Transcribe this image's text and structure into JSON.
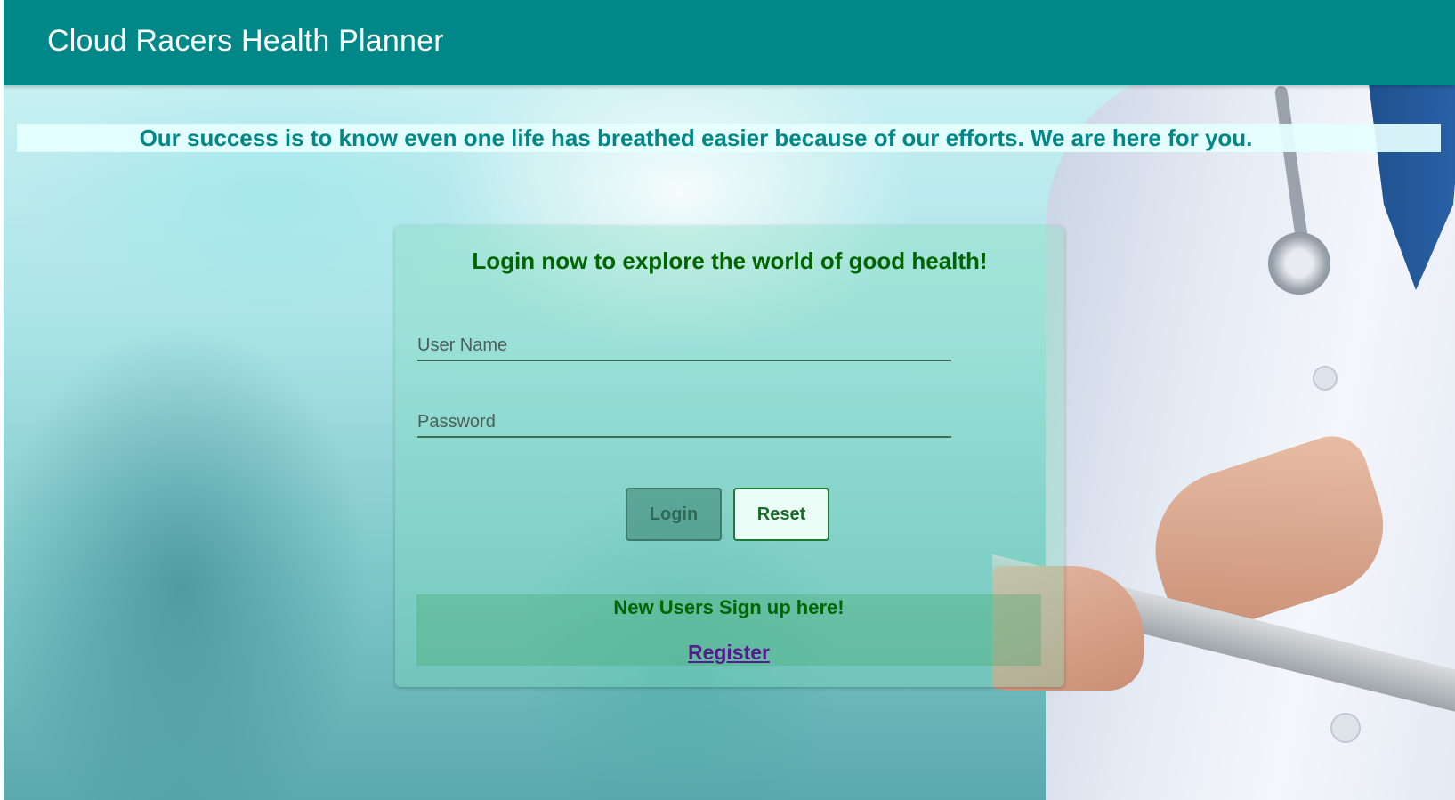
{
  "header": {
    "app_title": "Cloud Racers Health Planner"
  },
  "tagline": "Our success is to know even one life has breathed easier because of our efforts. We are here for you.",
  "login_card": {
    "title": "Login now to explore the world of good health!",
    "username_placeholder": "User Name",
    "username_value": "",
    "password_placeholder": "Password",
    "password_value": "",
    "login_label": "Login",
    "reset_label": "Reset",
    "signup_text": "New Users Sign up here!",
    "register_label": "Register"
  },
  "colors": {
    "navbar": "#008787",
    "tagline_text": "#008787",
    "card_title": "#006400",
    "register_link": "#551a8b"
  }
}
